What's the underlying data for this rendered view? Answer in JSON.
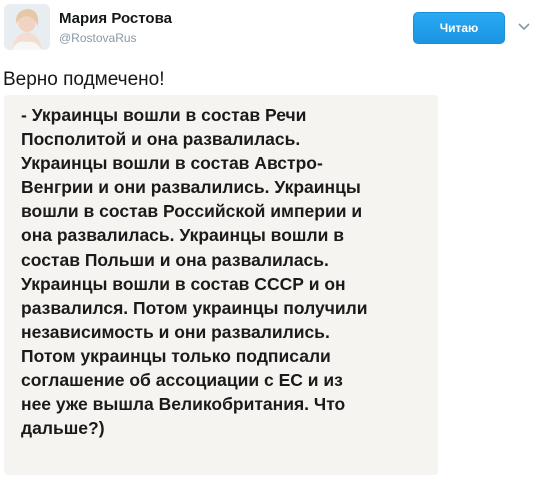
{
  "tweet": {
    "author_name": "Мария Ростова",
    "author_handle": "@RostovaRus",
    "follow_label": "Читаю",
    "text": "Верно подмечено!",
    "image_text_lines": [
      "- Украинцы вошли в состав Речи",
      "Посполитой и она развалилась.",
      "Украинцы вошли в состав Австро-",
      "Венгрии и они развалились. Украинцы",
      "вошли в состав Российской империи и",
      "она развалилась. Украинцы вошли в",
      "состав Польши и она развалилась.",
      "Украинцы вошли в состав СССР и он",
      "развалился. Потом украинцы получили",
      "независимость и они развалились.",
      "Потом украинцы только подписали",
      "соглашение об ассоциации с ЕС и из",
      "нее уже вышла Великобритания. Что",
      "дальше?)"
    ]
  },
  "icons": {
    "avatar": "avatar-photo",
    "menu": "chevron-down-icon"
  },
  "colors": {
    "follow_button": "#1da1f2",
    "handle": "#8899a6",
    "image_background": "#f6f4f1"
  }
}
